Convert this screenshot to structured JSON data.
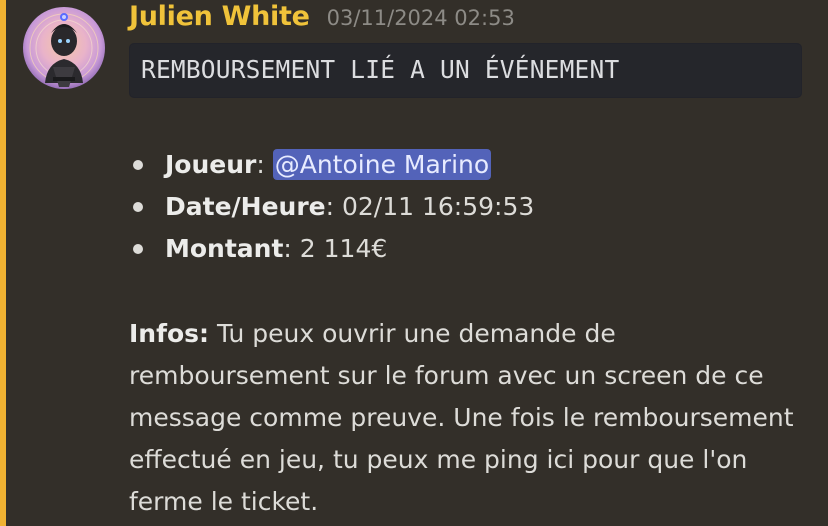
{
  "accent": {
    "highlight_bar": "#f0b232",
    "username": "#f0c33a",
    "mention_bg": "#5363b9",
    "background": "#332f29"
  },
  "message": {
    "author": "Julien White",
    "timestamp": "03/11/2024 02:53",
    "code_block": "REMBOURSEMENT LIÉ A UN ÉVÉNEMENT",
    "details": [
      {
        "key": "Joueur",
        "separator": ": ",
        "value": "",
        "mention": "@Antoine Marino"
      },
      {
        "key": "Date/Heure",
        "separator": ": ",
        "value": "02/11 16:59:53",
        "mention": ""
      },
      {
        "key": "Montant",
        "separator": ": ",
        "value": "2 114€",
        "mention": ""
      }
    ],
    "infos": {
      "label": "Infos:",
      "text": " Tu peux ouvrir une demande de remboursement sur le forum avec un screen de ce message comme preuve. Une fois le remboursement effectué en jeu, tu peux me ping ici pour que l'on ferme le ticket."
    }
  }
}
